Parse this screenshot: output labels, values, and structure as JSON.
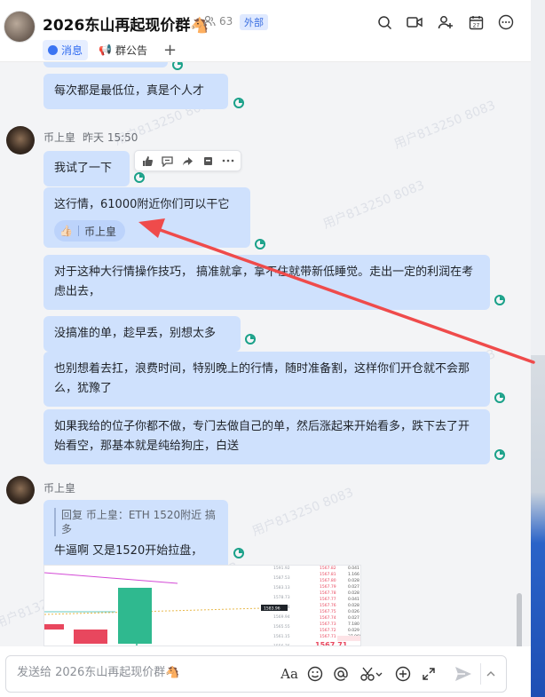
{
  "header": {
    "title": "2026东山再起现价群🐴",
    "member_count": "63",
    "badge": "外部",
    "tabs": [
      {
        "label": "消息",
        "active": true
      },
      {
        "label": "群公告",
        "active": false
      }
    ],
    "add_tab": "+"
  },
  "watermark": "用户813250 8083",
  "messages": [
    {
      "text": "每次都是最低位，真是个人才"
    },
    {
      "sender": "币上皇",
      "time": "昨天 15:50"
    },
    {
      "text": "我试了一下"
    },
    {
      "text": "这行情，61000附近你们可以干它",
      "reaction": {
        "emoji": "👍🏻",
        "user": "币上皇"
      }
    },
    {
      "text": "对于这种大行情操作技巧， 搞准就拿，拿不住就带新低睡觉。走出一定的利润在考虑出去，"
    },
    {
      "text": "没搞准的单，趁早丢，别想太多"
    },
    {
      "text": "也别想着去扛，浪费时间，特别晚上的行情，随时准备割，这样你们开仓就不会那么，犹豫了"
    },
    {
      "text": "如果我给的位子你都不做，专门去做自己的单，然后涨起来开始看多，跌下去了开始看空，那基本就是纯给狗庄，白送"
    },
    {
      "sender": "币上皇"
    },
    {
      "quote": "回复 币上皇：ETH 1520附近 搞多",
      "text": "牛逼啊 又是1520开始拉盘，"
    }
  ],
  "chart_image": {
    "price_label": "1567.71",
    "cursor_price": "1583.96",
    "sub_price": "$1,567.71",
    "ask_prices": [
      "1567.82",
      "1567.81",
      "1567.80",
      "1567.79",
      "1567.78",
      "1567.77",
      "1567.76",
      "1567.75",
      "1567.74",
      "1567.73",
      "1567.72",
      "1567.71"
    ],
    "ask_sizes": [
      "0.041",
      "1.166",
      "0.028",
      "0.027",
      "0.028",
      "0.041",
      "0.028",
      "0.026",
      "0.027",
      "7.180",
      "0.029",
      "37.960"
    ],
    "axis": [
      "1591.92",
      "1587.53",
      "1583.13",
      "1578.73",
      "1574.34",
      "1569.94",
      "1565.55",
      "1561.15",
      "1556.76"
    ]
  },
  "composer": {
    "placeholder": "发送给 2026东山再起现价群🐴",
    "font_icon": "Aa"
  },
  "colors": {
    "bubble": "#cfe1fd",
    "read_receipt": "#1aa189",
    "accent": "#2f6bf0",
    "arrow": "#ef4b4b"
  }
}
